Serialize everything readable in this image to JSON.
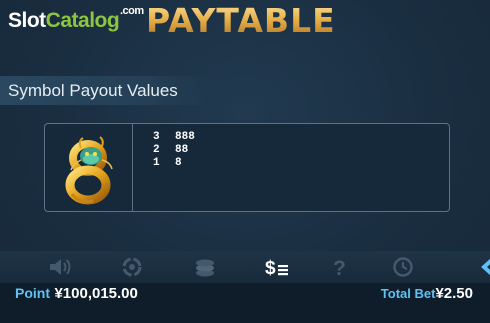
{
  "logo": {
    "slot": "Slot",
    "catalog": "Catalog",
    "com": ".com",
    "slot_color": "#ffffff",
    "catalog_color": "#8cc63f"
  },
  "page_title": "PAYTABLE",
  "section": {
    "label": "Symbol Payout Values"
  },
  "symbol": {
    "icon": "dragon-eight-icon",
    "payouts": [
      {
        "count": "3",
        "value": "888"
      },
      {
        "count": "2",
        "value": "88"
      },
      {
        "count": "1",
        "value": "8"
      }
    ]
  },
  "toolbar": {
    "items": [
      {
        "icon": "sound-icon",
        "active": false
      },
      {
        "icon": "autoplay-icon",
        "active": false
      },
      {
        "icon": "coins-icon",
        "active": false
      },
      {
        "icon": "paytable-icon",
        "active": true
      },
      {
        "icon": "help-icon",
        "active": false
      },
      {
        "icon": "history-icon",
        "active": false
      },
      {
        "icon": "arrow-icon",
        "active": false
      }
    ]
  },
  "status": {
    "point_label": "Point",
    "point_value": "¥100,015.00",
    "total_bet_label": "Total Bet",
    "total_bet_value": "¥2.50",
    "label_color": "#5ec2f4"
  }
}
